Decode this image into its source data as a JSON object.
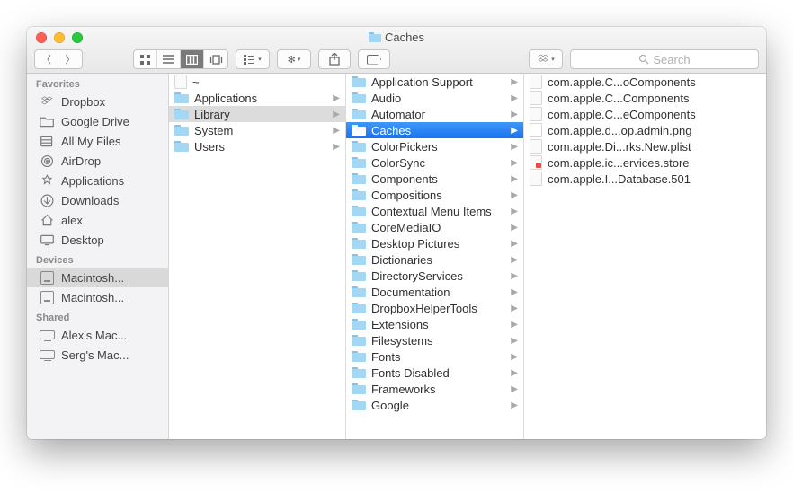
{
  "window_title": "Caches",
  "search_placeholder": "Search",
  "sidebar": {
    "groups": [
      {
        "label": "Favorites",
        "items": [
          {
            "icon": "dropbox",
            "label": "Dropbox"
          },
          {
            "icon": "folder",
            "label": "Google Drive"
          },
          {
            "icon": "all",
            "label": "All My Files"
          },
          {
            "icon": "airdrop",
            "label": "AirDrop"
          },
          {
            "icon": "apps",
            "label": "Applications"
          },
          {
            "icon": "downloads",
            "label": "Downloads"
          },
          {
            "icon": "home",
            "label": "alex"
          },
          {
            "icon": "desktop",
            "label": "Desktop"
          }
        ]
      },
      {
        "label": "Devices",
        "items": [
          {
            "icon": "drive",
            "label": "Macintosh...",
            "selected": true
          },
          {
            "icon": "drive",
            "label": "Macintosh..."
          }
        ]
      },
      {
        "label": "Shared",
        "items": [
          {
            "icon": "remote",
            "label": "Alex's Mac..."
          },
          {
            "icon": "remote",
            "label": "Serg's Mac..."
          }
        ]
      }
    ]
  },
  "columns": [
    {
      "items": [
        {
          "type": "doc",
          "label": "~"
        },
        {
          "type": "folder",
          "label": "Applications",
          "arrow": true
        },
        {
          "type": "folder",
          "label": "Library",
          "arrow": true,
          "selected": "inactive"
        },
        {
          "type": "folder",
          "label": "System",
          "arrow": true
        },
        {
          "type": "folder",
          "label": "Users",
          "arrow": true
        }
      ]
    },
    {
      "items": [
        {
          "type": "folder",
          "label": "Application Support",
          "arrow": true
        },
        {
          "type": "folder",
          "label": "Audio",
          "arrow": true
        },
        {
          "type": "folder",
          "label": "Automator",
          "arrow": true
        },
        {
          "type": "folder",
          "label": "Caches",
          "arrow": true,
          "selected": "active"
        },
        {
          "type": "folder",
          "label": "ColorPickers",
          "arrow": true
        },
        {
          "type": "folder",
          "label": "ColorSync",
          "arrow": true
        },
        {
          "type": "folder",
          "label": "Components",
          "arrow": true
        },
        {
          "type": "folder",
          "label": "Compositions",
          "arrow": true
        },
        {
          "type": "folder",
          "label": "Contextual Menu Items",
          "arrow": true
        },
        {
          "type": "folder",
          "label": "CoreMediaIO",
          "arrow": true
        },
        {
          "type": "folder",
          "label": "Desktop Pictures",
          "arrow": true
        },
        {
          "type": "folder",
          "label": "Dictionaries",
          "arrow": true
        },
        {
          "type": "folder",
          "label": "DirectoryServices",
          "arrow": true
        },
        {
          "type": "folder",
          "label": "Documentation",
          "arrow": true
        },
        {
          "type": "folder",
          "label": "DropboxHelperTools",
          "arrow": true
        },
        {
          "type": "folder",
          "label": "Extensions",
          "arrow": true
        },
        {
          "type": "folder",
          "label": "Filesystems",
          "arrow": true
        },
        {
          "type": "folder",
          "label": "Fonts",
          "arrow": true
        },
        {
          "type": "folder",
          "label": "Fonts Disabled",
          "arrow": true
        },
        {
          "type": "folder",
          "label": "Frameworks",
          "arrow": true
        },
        {
          "type": "folder",
          "label": "Google",
          "arrow": true
        }
      ]
    },
    {
      "items": [
        {
          "type": "doc",
          "label": "com.apple.C...oComponents"
        },
        {
          "type": "doc",
          "label": "com.apple.C...Components"
        },
        {
          "type": "doc",
          "label": "com.apple.C...eComponents"
        },
        {
          "type": "img",
          "label": "com.apple.d...op.admin.png"
        },
        {
          "type": "doc",
          "label": "com.apple.Di...rks.New.plist"
        },
        {
          "type": "red",
          "label": "com.apple.ic...ervices.store"
        },
        {
          "type": "doc",
          "label": "com.apple.I...Database.501"
        }
      ]
    }
  ]
}
